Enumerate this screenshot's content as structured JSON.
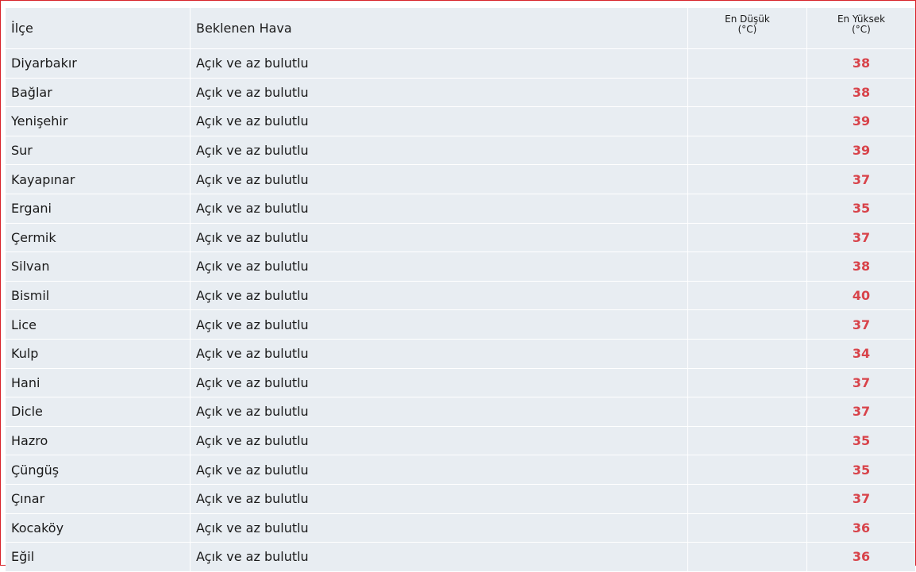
{
  "table": {
    "headers": {
      "district": "İlçe",
      "weather": "Beklenen Hava",
      "low_line1": "En Düşük",
      "low_line2": "(°C)",
      "high_line1": "En Yüksek",
      "high_line2": "(°C)"
    },
    "rows": [
      {
        "district": "Diyarbakır",
        "weather": "Açık ve az bulutlu",
        "low": "",
        "high": "38"
      },
      {
        "district": "Bağlar",
        "weather": "Açık ve az bulutlu",
        "low": "",
        "high": "38"
      },
      {
        "district": "Yenişehir",
        "weather": "Açık ve az bulutlu",
        "low": "",
        "high": "39"
      },
      {
        "district": "Sur",
        "weather": "Açık ve az bulutlu",
        "low": "",
        "high": "39"
      },
      {
        "district": "Kayapınar",
        "weather": "Açık ve az bulutlu",
        "low": "",
        "high": "37"
      },
      {
        "district": "Ergani",
        "weather": "Açık ve az bulutlu",
        "low": "",
        "high": "35"
      },
      {
        "district": "Çermik",
        "weather": "Açık ve az bulutlu",
        "low": "",
        "high": "37"
      },
      {
        "district": "Silvan",
        "weather": "Açık ve az bulutlu",
        "low": "",
        "high": "38"
      },
      {
        "district": "Bismil",
        "weather": "Açık ve az bulutlu",
        "low": "",
        "high": "40"
      },
      {
        "district": "Lice",
        "weather": "Açık ve az bulutlu",
        "low": "",
        "high": "37"
      },
      {
        "district": "Kulp",
        "weather": "Açık ve az bulutlu",
        "low": "",
        "high": "34"
      },
      {
        "district": "Hani",
        "weather": "Açık ve az bulutlu",
        "low": "",
        "high": "37"
      },
      {
        "district": "Dicle",
        "weather": "Açık ve az bulutlu",
        "low": "",
        "high": "37"
      },
      {
        "district": "Hazro",
        "weather": "Açık ve az bulutlu",
        "low": "",
        "high": "35"
      },
      {
        "district": "Çüngüş",
        "weather": "Açık ve az bulutlu",
        "low": "",
        "high": "35"
      },
      {
        "district": "Çınar",
        "weather": "Açık ve az bulutlu",
        "low": "",
        "high": "37"
      },
      {
        "district": "Kocaköy",
        "weather": "Açık ve az bulutlu",
        "low": "",
        "high": "36"
      },
      {
        "district": "Eğil",
        "weather": "Açık ve az bulutlu",
        "low": "",
        "high": "36"
      }
    ]
  },
  "colors": {
    "frame_border": "#d8232a",
    "cell_background": "#e8edf2",
    "high_temperature": "#d8434a"
  }
}
